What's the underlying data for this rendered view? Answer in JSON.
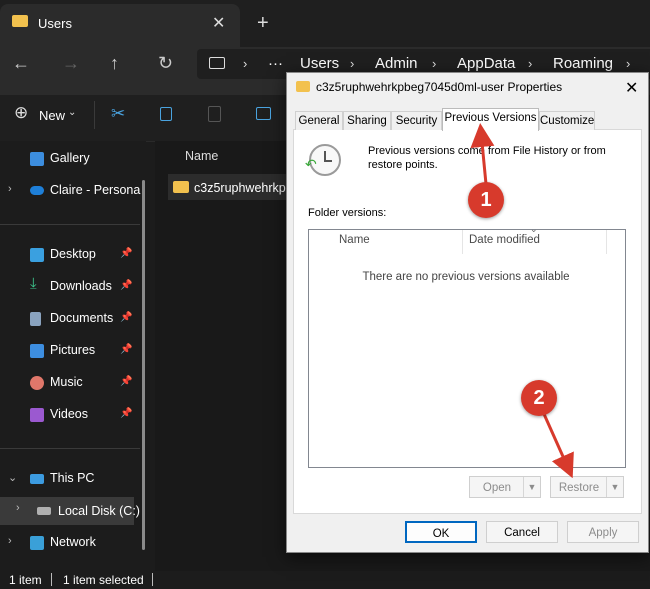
{
  "window": {
    "tab_title": "Users",
    "tab_close": "✕",
    "tab_add": "+"
  },
  "address": {
    "overflow": "···",
    "crumbs": [
      "Users",
      "Admin",
      "AppData",
      "Roaming"
    ]
  },
  "toolbar": {
    "new_label": "New"
  },
  "sidebar": {
    "items": [
      {
        "label": "Gallery"
      },
      {
        "label": "Claire - Persona"
      },
      {
        "label": "Desktop"
      },
      {
        "label": "Downloads"
      },
      {
        "label": "Documents"
      },
      {
        "label": "Pictures"
      },
      {
        "label": "Music"
      },
      {
        "label": "Videos"
      },
      {
        "label": "This PC"
      },
      {
        "label": "Local Disk (C:)"
      },
      {
        "label": "Network"
      }
    ]
  },
  "main": {
    "column_name": "Name",
    "folder_name": "c3z5ruphwehrkpb"
  },
  "status": {
    "count": "1 item",
    "selected": "1 item selected"
  },
  "dialog": {
    "title": "c3z5ruphwehrkpbeg7045d0ml-user Properties",
    "tabs": [
      "General",
      "Sharing",
      "Security",
      "Previous Versions",
      "Customize"
    ],
    "info": "Previous versions come from File History or from restore points.",
    "folder_versions_label": "Folder versions:",
    "columns": [
      "Name",
      "Date modified"
    ],
    "empty_message": "There are no previous versions available",
    "open_label": "Open",
    "restore_label": "Restore",
    "ok_label": "OK",
    "cancel_label": "Cancel",
    "apply_label": "Apply"
  },
  "annotations": [
    "1",
    "2"
  ],
  "colors": {
    "accent": "#0067c0",
    "annotation": "#d73a2c",
    "folder": "#f2c14e"
  }
}
